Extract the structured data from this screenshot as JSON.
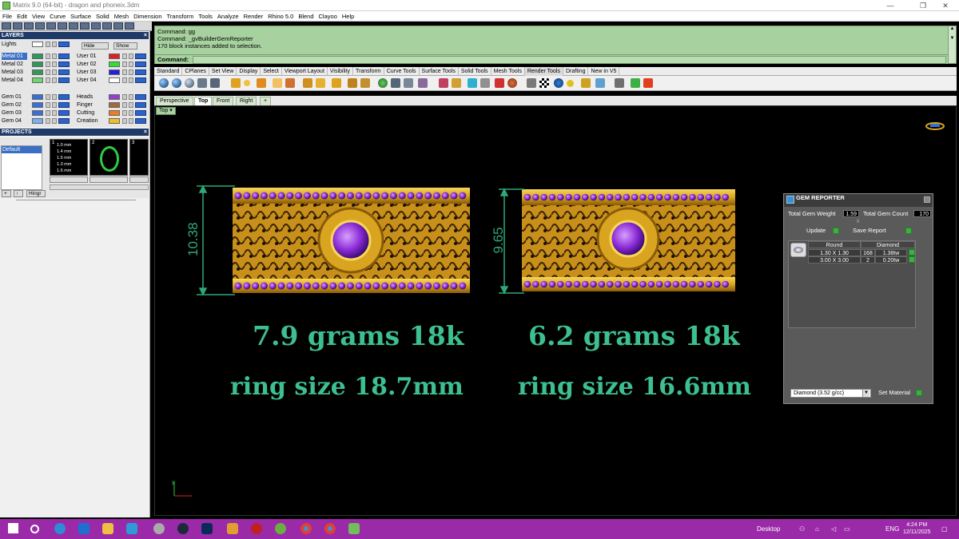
{
  "window": {
    "title": "Matrix 9.0 (64-bit) - dragon and phoneix.3dm",
    "minimize_glyph": "—",
    "maximize_glyph": "❐",
    "close_glyph": "✕"
  },
  "menu": [
    "File",
    "Edit",
    "View",
    "Curve",
    "Surface",
    "Solid",
    "Mesh",
    "Dimension",
    "Transform",
    "Tools",
    "Analyze",
    "Render",
    "Rhino 5.0",
    "Blend",
    "Clayoo",
    "Help"
  ],
  "layers": {
    "header": "LAYERS",
    "left": [
      {
        "name": "Lights",
        "color": "#ffffff"
      },
      {
        "name": "Metal 01",
        "color": "#2e9a5a",
        "selected": true
      },
      {
        "name": "Metal 02",
        "color": "#2e9a5a"
      },
      {
        "name": "Metal 03",
        "color": "#2e9a5a"
      },
      {
        "name": "Metal 04",
        "color": "#6fd66f"
      },
      {
        "name": "Gem 01",
        "color": "#3a6fd6"
      },
      {
        "name": "Gem 02",
        "color": "#3a6fd6"
      },
      {
        "name": "Gem 03",
        "color": "#3a6fd6"
      },
      {
        "name": "Gem 04",
        "color": "#7ab0f0"
      }
    ],
    "right": [
      {
        "name": "User 01",
        "color": "#e02020"
      },
      {
        "name": "User 02",
        "color": "#30e030"
      },
      {
        "name": "User 03",
        "color": "#2020e0"
      },
      {
        "name": "User 04",
        "color": "#ffffff"
      },
      {
        "name": "Heads",
        "color": "#9a3ad0"
      },
      {
        "name": "Finger",
        "color": "#a06a3a"
      },
      {
        "name": "Cutting",
        "color": "#f07a20"
      },
      {
        "name": "Creation",
        "color": "#f0c020"
      }
    ],
    "hide_label": "Hide",
    "show_label": "Show"
  },
  "projects": {
    "header": "PROJECTS",
    "items": [
      "Default"
    ],
    "thumb_numbers": [
      "1",
      "2",
      "3"
    ],
    "thumb1_sizes": [
      "1.0 mm",
      "1.4 mm",
      "1.5 mm",
      "1.3 mm",
      "1.6 mm"
    ],
    "add_label": "+",
    "up_label": "↑",
    "hinge_label": "Hingr"
  },
  "command": {
    "lines": [
      "Command: gg",
      "Command: _gvBuilderGemReporter",
      "170 block instances added to selection."
    ],
    "prompt_label": "Command:"
  },
  "toolbar_tabs": [
    "Standard",
    "CPlanes",
    "Set View",
    "Display",
    "Select",
    "Viewport Layout",
    "Visibility",
    "Transform",
    "Curve Tools",
    "Surface Tools",
    "Solid Tools",
    "Mesh Tools",
    "Render Tools",
    "Drafting",
    "New in V5"
  ],
  "toolbar_active": "Render Tools",
  "viewport_tabs": [
    "Perspective",
    "Top",
    "Front",
    "Right"
  ],
  "viewport_tab_add": "+",
  "viewport_active": "Top",
  "viewport_label": "Top",
  "axis_label": "y",
  "renders": {
    "left_dimension": "10.38",
    "right_dimension": "9.65",
    "left_weight": "7.9 grams 18k",
    "right_weight": "6.2 grams 18k",
    "left_size": "ring size 18.7mm",
    "right_size": "ring size 16.6mm",
    "metal_color": "#d9a520",
    "gem_color": "#8a2bd6"
  },
  "gem_reporter": {
    "title": "GEM REPORTER",
    "total_weight_label": "Total Gem Weight",
    "total_weight_value": "1.59",
    "total_count_label": "Total Gem Count",
    "total_count_value": "170",
    "update_label": "Update",
    "save_report_label": "Save Report",
    "columns": [
      "Round",
      "Diamond"
    ],
    "rows": [
      {
        "size": "1.30 X 1.30",
        "count": "168",
        "weight": "1.38tw"
      },
      {
        "size": "3.00 X 3.00",
        "count": "2",
        "weight": "0.20tw"
      }
    ],
    "material_select": "Diamond    (3.52 g/cc)",
    "set_material_label": "Set Material"
  },
  "taskbar": {
    "desktop_label": "Desktop",
    "lang": "ENG",
    "time": "4:24 PM",
    "date": "12/11/2025",
    "accent": "#9a2aa7"
  }
}
